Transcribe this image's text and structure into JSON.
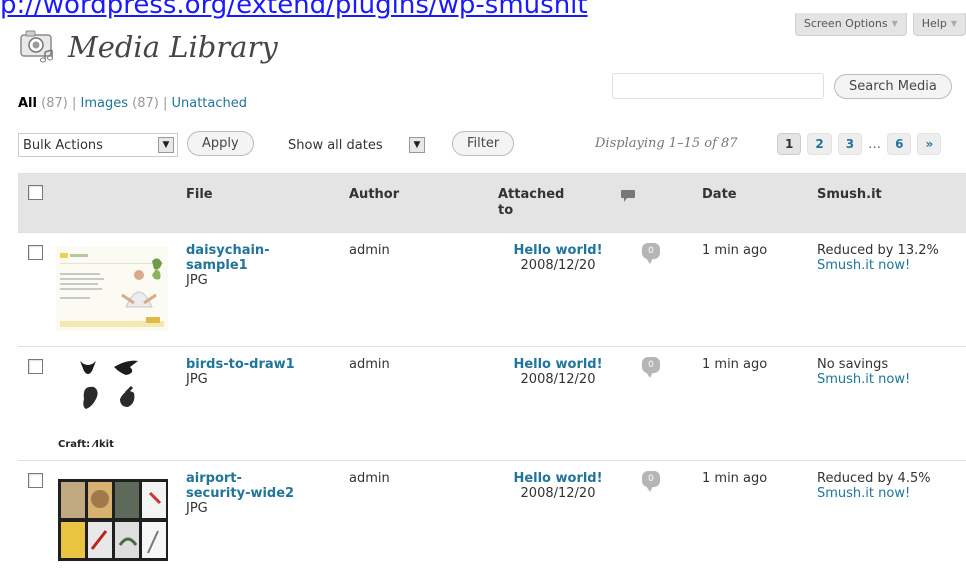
{
  "url_text": "p://wordpress.org/extend/plugins/wp-smushit",
  "top_tabs": {
    "screen_options": "Screen Options",
    "help": "Help"
  },
  "page_title": "Media Library",
  "filters": {
    "all_label": "All",
    "all_count": "(87)",
    "images_label": "Images",
    "images_count": "(87)",
    "unattached_label": "Unattached",
    "separator": "|"
  },
  "search": {
    "button_label": "Search Media",
    "value": ""
  },
  "tablenav": {
    "bulk_actions": "Bulk Actions",
    "apply_label": "Apply",
    "dates": "Show all dates",
    "filter_label": "Filter",
    "displaying": "Displaying 1–15 of 87",
    "pages": [
      "1",
      "2",
      "3",
      "6"
    ],
    "dots": "…",
    "next": "»"
  },
  "columns": {
    "file": "File",
    "author": "Author",
    "attached_to": "Attached to",
    "date": "Date",
    "smush": "Smush.it"
  },
  "rows": [
    {
      "file": "daisychain-sample1",
      "type": "JPG",
      "author": "admin",
      "attached_title": "Hello world!",
      "attached_date": "2008/12/20",
      "comments": "0",
      "date": "1 min ago",
      "smush_status": "Reduced by 13.2%",
      "smush_link": "Smush.it now!"
    },
    {
      "file": "birds-to-draw1",
      "type": "JPG",
      "author": "admin",
      "attached_title": "Hello world!",
      "attached_date": "2008/12/20",
      "comments": "0",
      "date": "1 min ago",
      "smush_status": "No savings",
      "smush_link": "Smush.it now!",
      "thumb_caption": "Craft: ⁄Ikit"
    },
    {
      "file": "airport-security-wide2",
      "type": "JPG",
      "author": "admin",
      "attached_title": "Hello world!",
      "attached_date": "2008/12/20",
      "comments": "0",
      "date": "1 min ago",
      "smush_status": "Reduced by 4.5%",
      "smush_link": "Smush.it now!"
    }
  ],
  "colors": {
    "link": "#21759b",
    "header_bg": "#e4e4e4",
    "border": "#dfdfdf"
  }
}
